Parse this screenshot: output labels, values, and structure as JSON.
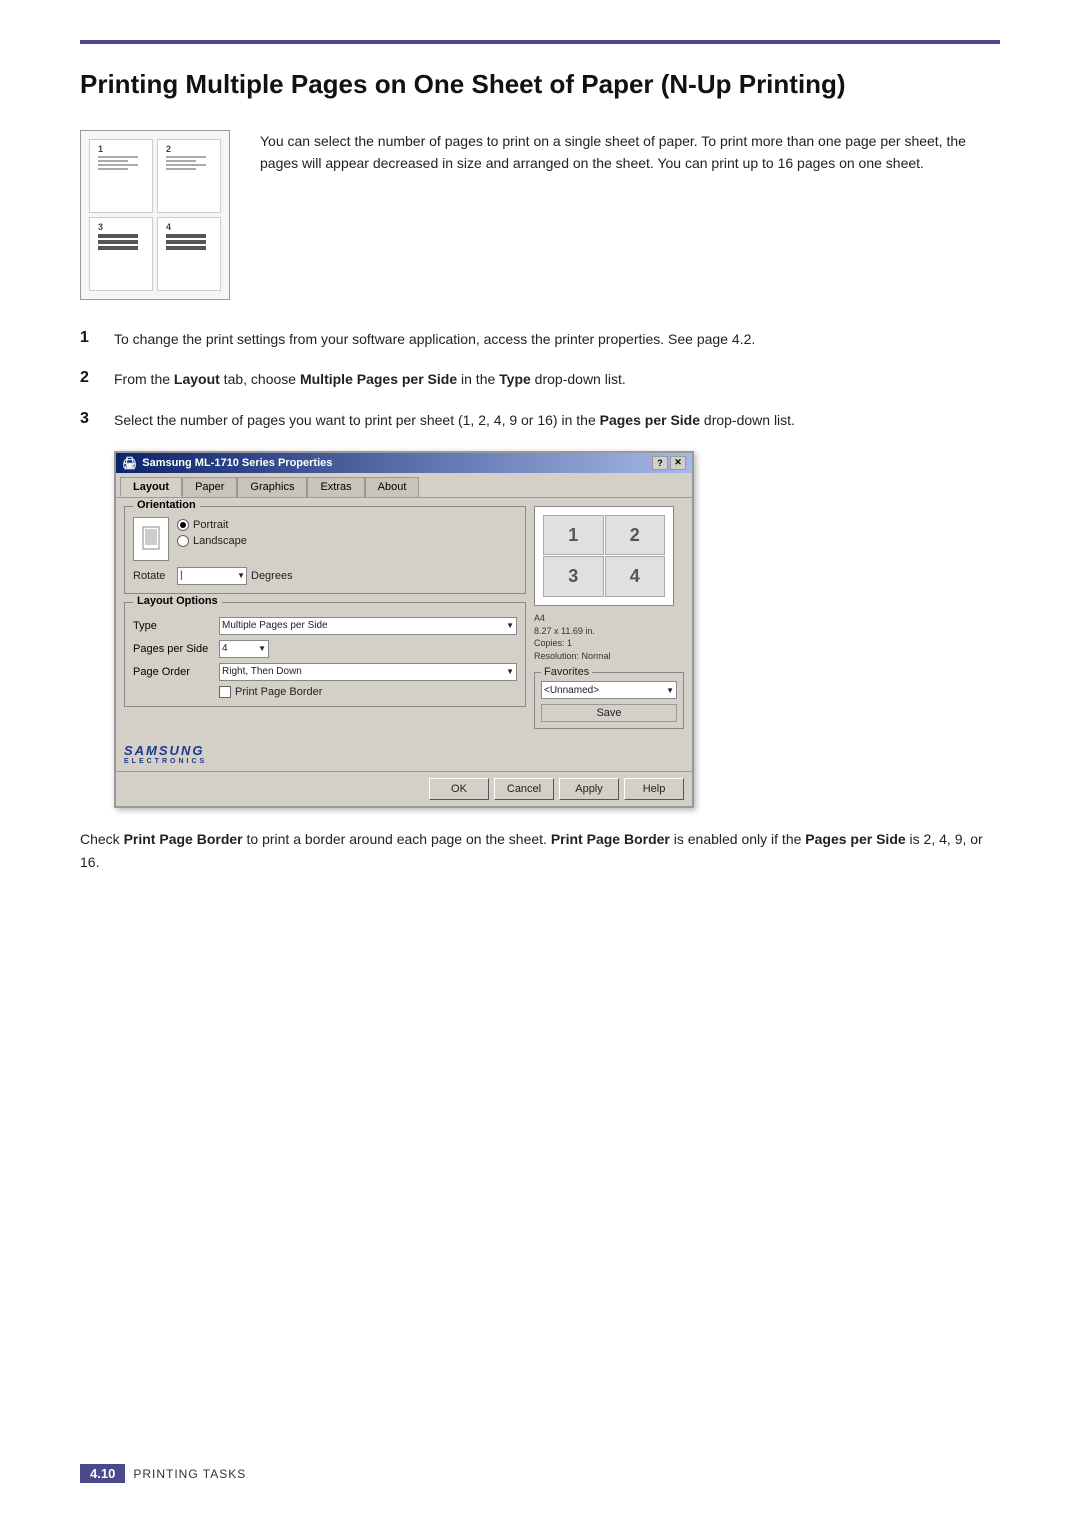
{
  "page": {
    "title": "Printing Multiple Pages on One Sheet of Paper (N-Up Printing)",
    "top_border_color": "#4a4a8a"
  },
  "intro": {
    "text": "You can select the number of pages to print on a single sheet of paper. To print more than one page per sheet, the pages will appear decreased in size and arranged on the sheet. You can print up to 16 pages on one sheet."
  },
  "steps": [
    {
      "number": "1",
      "text": "To change the print settings from your software application, access the printer properties. See page 4.2."
    },
    {
      "number": "2",
      "text": "From the Layout tab, choose Multiple Pages per Side in the Type drop-down list."
    },
    {
      "number": "3",
      "text": "Select the number of pages you want to print per sheet (1, 2, 4, 9 or 16) in the Pages per Side drop-down list."
    }
  ],
  "dialog": {
    "title": "Samsung ML-1710 Series Properties",
    "tabs": [
      "Layout",
      "Paper",
      "Graphics",
      "Extras",
      "About"
    ],
    "active_tab": "Layout",
    "orientation": {
      "label": "Orientation",
      "options": [
        "Portrait",
        "Landscape"
      ],
      "selected": "Portrait",
      "rotate_label": "Rotate",
      "degrees_label": "Degrees"
    },
    "layout_options": {
      "label": "Layout Options",
      "type_label": "Type",
      "type_value": "Multiple Pages per Side",
      "pages_per_side_label": "Pages per Side",
      "pages_per_side_value": "4",
      "page_order_label": "Page Order",
      "page_order_value": "Right, Then Down",
      "print_page_border_label": "Print Page Border"
    },
    "preview": {
      "cells": [
        "1",
        "2",
        "3",
        "4"
      ],
      "paper_size": "A4",
      "dimensions": "8.27 x 11.69 in.",
      "copies": "Copies: 1",
      "resolution": "Resolution: Normal"
    },
    "favorites": {
      "label": "Favorites",
      "value": "<Unnamed>",
      "save_label": "Save"
    },
    "buttons": {
      "ok": "OK",
      "cancel": "Cancel",
      "apply": "Apply",
      "help": "Help"
    },
    "samsung_logo": "SAMSUNG",
    "samsung_sub": "ELECTRONICS"
  },
  "bottom_text": "Check Print Page Border to print a border around each page on the sheet. Print Page Border is enabled only if the Pages per Side is 2, 4, 9, or 16.",
  "footer": {
    "page_num": "4.10",
    "text": "Printing Tasks"
  },
  "titlebar_buttons": {
    "question": "?",
    "close": "✕"
  }
}
